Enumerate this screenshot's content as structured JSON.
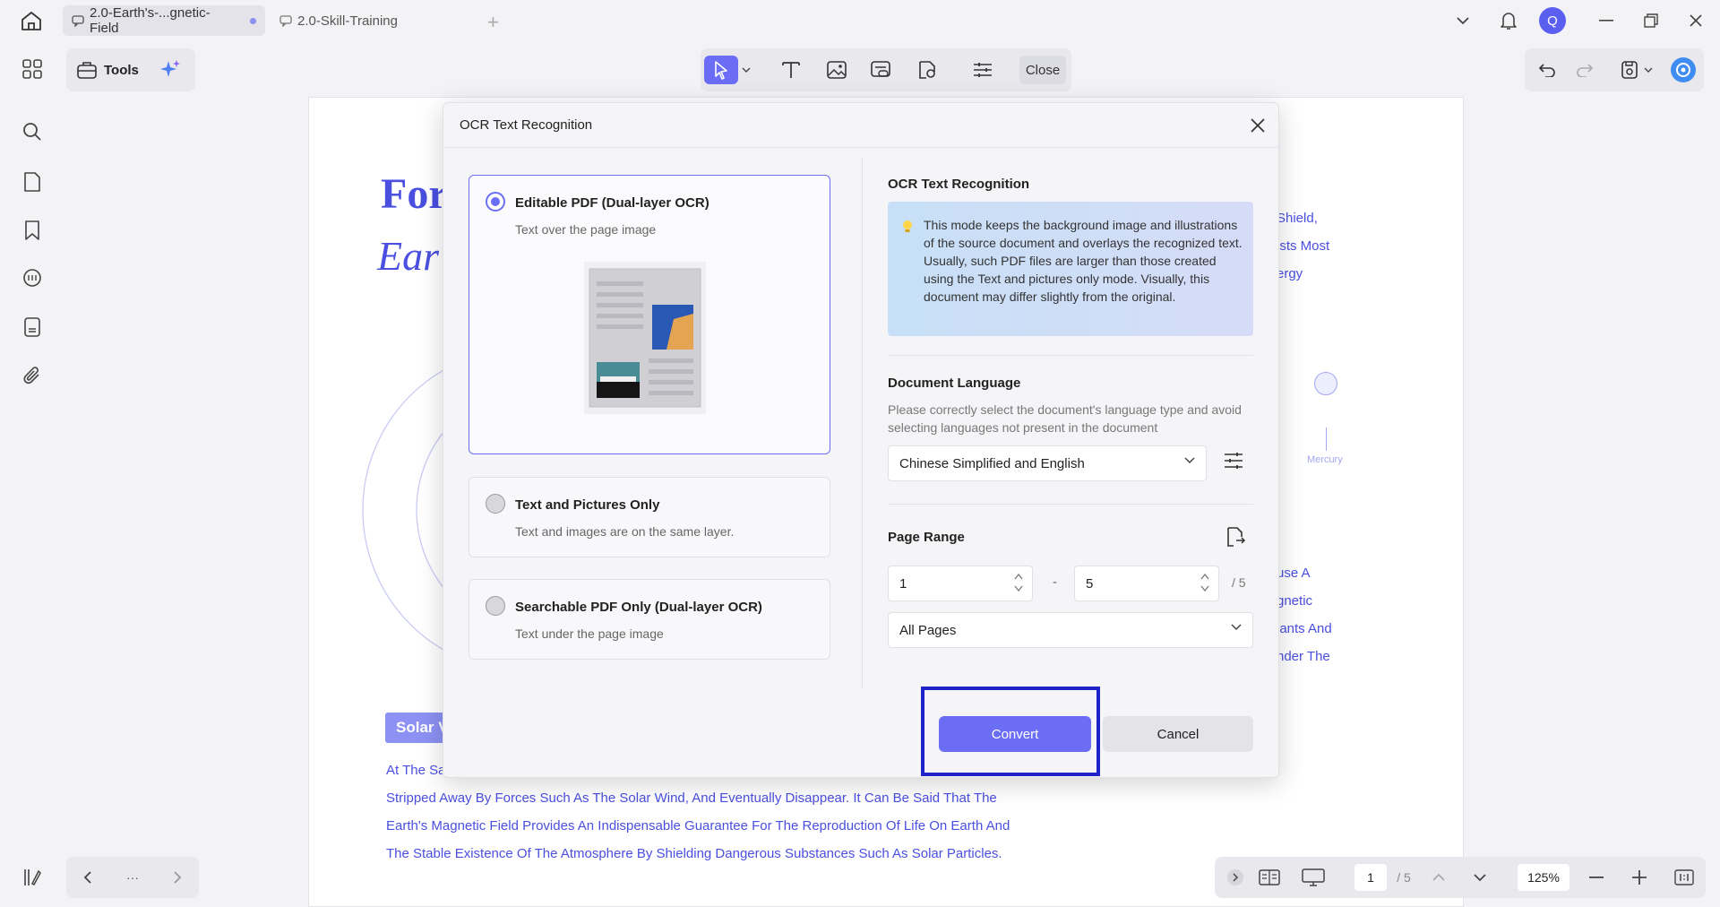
{
  "tabs": [
    {
      "title": "2.0-Earth's-...gnetic-Field",
      "active": true
    },
    {
      "title": "2.0-Skill-Training",
      "active": false
    }
  ],
  "user": {
    "avatar_letter": "Q"
  },
  "toolbar": {
    "tools_label": "Tools",
    "close_label": "Close"
  },
  "document": {
    "title_line1": "For",
    "title_line2": "Ear",
    "right_lines_top": [
      "Shield,",
      "ists Most",
      "ergy"
    ],
    "right_lines_mid": [
      "use A",
      "gnetic",
      "lants And",
      "nder The"
    ],
    "mercury_label": "Mercury",
    "badge": "Solar V",
    "paragraph": [
      "At The Sa",
      "Stripped Away By Forces Such As The Solar Wind, And Eventually Disappear. It Can Be Said That The",
      "Earth's Magnetic Field Provides An Indispensable Guarantee For The Reproduction Of Life On Earth And",
      "The Stable Existence Of The Atmosphere By Shielding Dangerous Substances Such As Solar Particles."
    ]
  },
  "bottom": {
    "more": "···",
    "page_current": "1",
    "page_total": "/ 5",
    "zoom": "125%"
  },
  "dialog": {
    "title": "OCR Text Recognition",
    "options": [
      {
        "title": "Editable PDF (Dual-layer OCR)",
        "subtitle": "Text over the page image",
        "selected": true
      },
      {
        "title": "Text and Pictures Only",
        "subtitle": "Text and images are on the same layer.",
        "selected": false
      },
      {
        "title": "Searchable PDF Only (Dual-layer OCR)",
        "subtitle": "Text under the page image",
        "selected": false
      }
    ],
    "right": {
      "section_title": "OCR Text Recognition",
      "info": "This mode keeps the background image and illustrations of the source document and overlays the recognized text. Usually, such PDF files are larger than those created using the Text and pictures only mode. Visually, this document may differ slightly from the original.",
      "lang_title": "Document Language",
      "lang_desc": "Please correctly select the document's language type and avoid selecting languages not present in the document",
      "lang_value": "Chinese Simplified and English",
      "range_title": "Page Range",
      "range_from": "1",
      "range_to": "5",
      "range_sep": "-",
      "range_total": "/ 5",
      "pages_value": "All Pages"
    },
    "convert_label": "Convert",
    "cancel_label": "Cancel"
  },
  "colors": {
    "accent": "#6b6ef5",
    "doc_text": "#4a4fe0",
    "highlight": "#1e22c8"
  }
}
